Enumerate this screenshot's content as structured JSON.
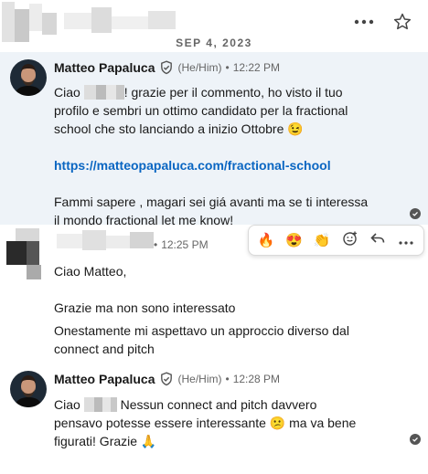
{
  "header": {
    "more_icon": "more-horizontal-icon",
    "star_icon": "star-outline-icon"
  },
  "date_separator": "SEP 4, 2023",
  "messages": [
    {
      "sender": "Matteo Papaluca",
      "pronoun": "(He/Him)",
      "time": "12:22 PM",
      "lines": [
        {
          "pre": "Ciao",
          "post": "! grazie per il commento, ho visto il tuo"
        },
        "profilo e sembri un ottimo candidato per la fractional",
        "school che sto lanciando a inizio Ottobre 😉",
        "",
        "https://matteopapaluca.com/fractional-school",
        "",
        "Fammi sapere , magari sei giá avanti ma se ti interessa",
        "il mondo fractional let me know!"
      ]
    },
    {
      "time": "12:25 PM",
      "lines": [
        "Ciao Matteo,",
        "",
        "Grazie ma non sono interessato",
        "Onestamente mi aspettavo un approccio diverso dal",
        "connect and pitch"
      ]
    },
    {
      "sender": "Matteo Papaluca",
      "pronoun": "(He/Him)",
      "time": "12:28 PM",
      "lines": [
        {
          "pre": "Ciao",
          "post": "Nessun connect and pitch davvero"
        },
        "pensavo potesse essere interessante 😕 ma va bene",
        "figurati! Grazie 🙏"
      ]
    }
  ],
  "reactions": [
    "🔥",
    "😍",
    "👏",
    "add-emoji-icon",
    "reply-icon",
    "more-horizontal-icon"
  ],
  "colors": {
    "link": "#0a66c2",
    "highlight": "#eef3f8",
    "muted": "#666666"
  }
}
